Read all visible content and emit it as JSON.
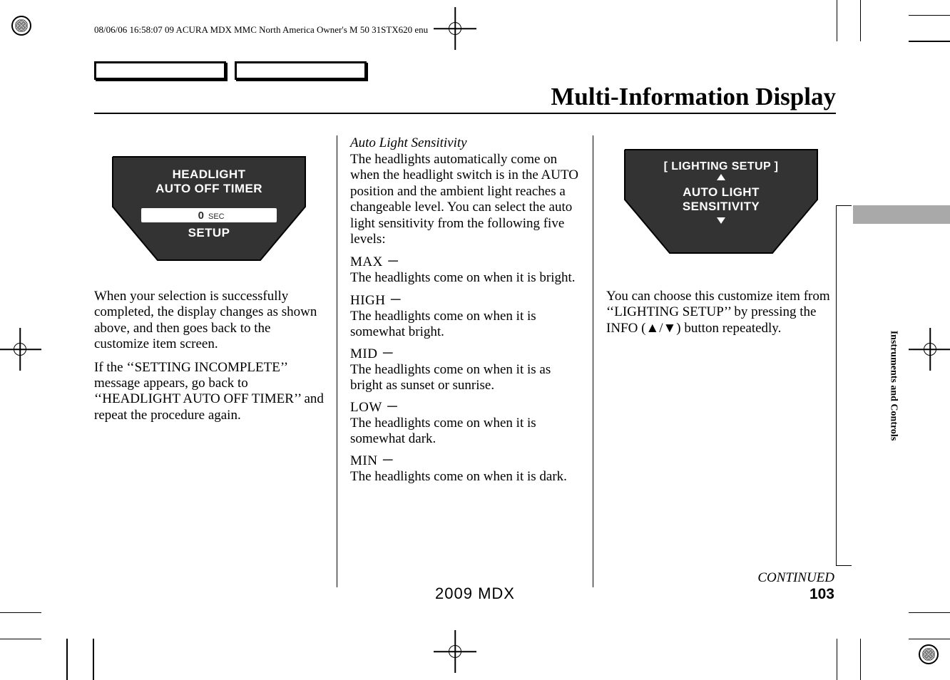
{
  "header": {
    "meta_line": "08/06/06 16:58:07   09 ACURA MDX MMC North America Owner's M 50 31STX620 enu"
  },
  "title": "Multi-Information Display",
  "side_tab_label": "Instruments and Controls",
  "col1": {
    "illustration": {
      "line1": "HEADLIGHT",
      "line2": "AUTO OFF TIMER",
      "value_prefix": "0",
      "value_unit": "SEC",
      "footer": "SETUP"
    },
    "p1": "When your selection is successfully completed, the display changes as shown above, and then goes back to the customize item screen.",
    "p2": "If the ‘‘SETTING INCOMPLETE’’ message appears, go back to ‘‘HEADLIGHT AUTO OFF TIMER’’ and repeat the procedure again."
  },
  "col2": {
    "subhead": "Auto Light Sensitivity",
    "intro": "The headlights automatically come on when the headlight switch is in the AUTO position and the ambient light reaches a changeable level. You can select the auto light sensitivity from the following five levels:",
    "levels": [
      {
        "label": "MAX",
        "desc": "The headlights come on when it is bright."
      },
      {
        "label": "HIGH",
        "desc": "The headlights come on when it is somewhat bright."
      },
      {
        "label": "MID",
        "desc": "The headlights come on when it is as bright as sunset or sunrise."
      },
      {
        "label": "LOW",
        "desc": "The headlights come on when it is somewhat dark."
      },
      {
        "label": "MIN",
        "desc": "The headlights come on when it is dark."
      }
    ]
  },
  "col3": {
    "illustration": {
      "title": "[ LIGHTING SETUP ]",
      "line1": "AUTO LIGHT",
      "line2": "SENSITIVITY"
    },
    "p1": "You can choose this customize item from ‘‘LIGHTING SETUP’’ by pressing the INFO (▲/▼) button repeatedly."
  },
  "footer": {
    "continued": "CONTINUED",
    "year_model": "2009  MDX",
    "page_num": "103"
  }
}
